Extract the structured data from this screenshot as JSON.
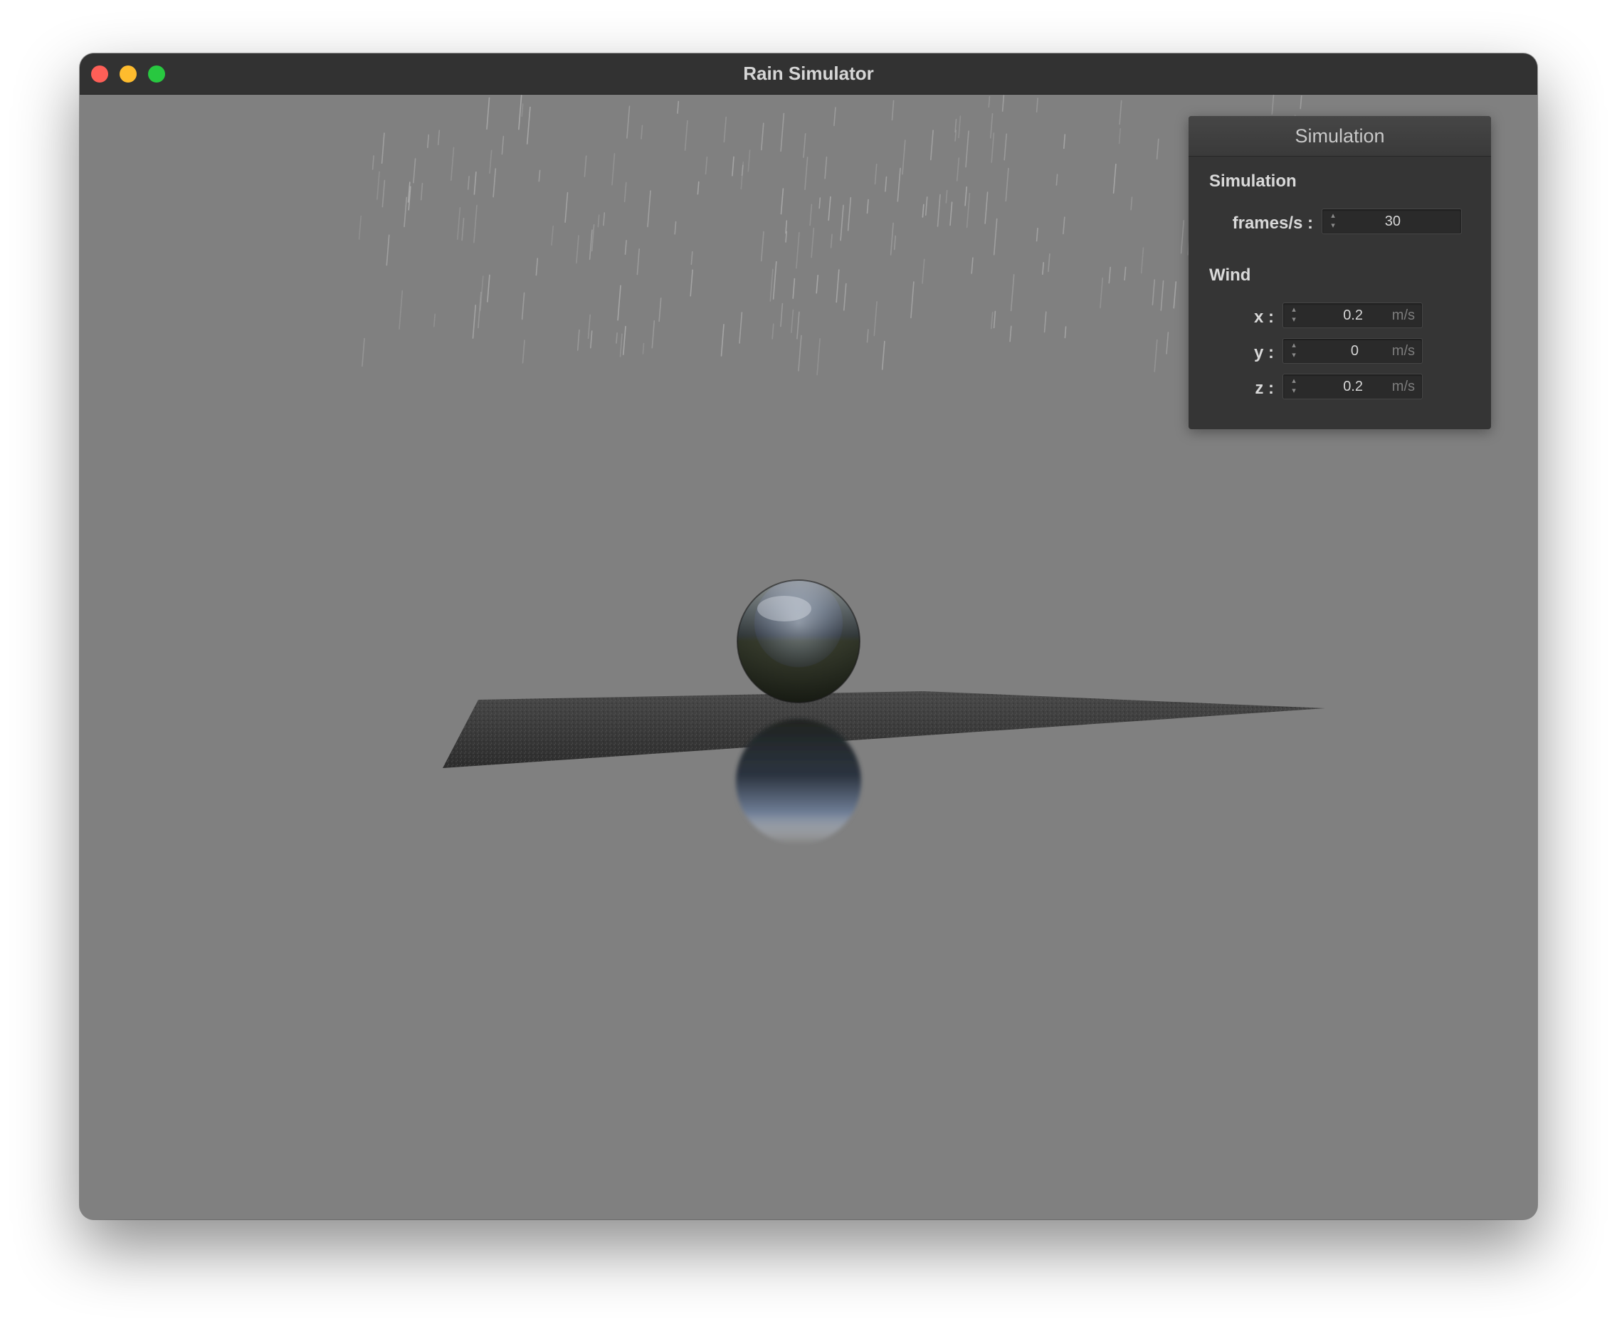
{
  "window": {
    "title": "Rain Simulator"
  },
  "panel": {
    "title": "Simulation",
    "simulation_group": {
      "label": "Simulation",
      "fps_label": "frames/s :",
      "fps_value": "30"
    },
    "wind_group": {
      "label": "Wind",
      "x": {
        "label": "x :",
        "value": "0.2",
        "unit": "m/s"
      },
      "y": {
        "label": "y :",
        "value": "0",
        "unit": "m/s"
      },
      "z": {
        "label": "z :",
        "value": "0.2",
        "unit": "m/s"
      }
    }
  },
  "icons": {
    "spinner_up": "▴",
    "spinner_down": "▾"
  },
  "colors": {
    "background": "#808080",
    "titlebar": "#323232",
    "panel": "#353535",
    "close": "#fe5f57",
    "minimize": "#febc2e",
    "maximize": "#28c840"
  }
}
